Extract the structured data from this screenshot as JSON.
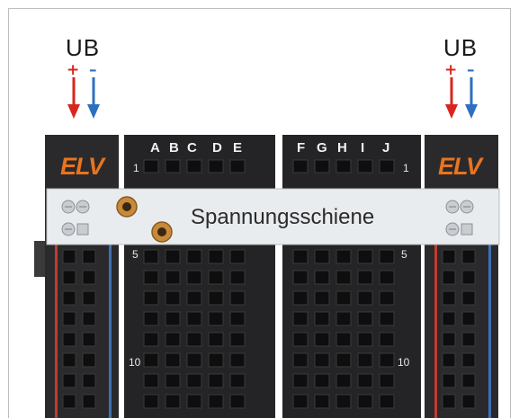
{
  "left_rail": {
    "title": "UB",
    "plus": "+",
    "minus": "–"
  },
  "right_rail": {
    "title": "UB",
    "plus": "+",
    "minus": "–"
  },
  "brand": {
    "left_logo": "ELV",
    "right_logo": "ELV"
  },
  "bar": {
    "label": "Spannungsschiene"
  },
  "columns_left": [
    "A",
    "B",
    "C",
    "D",
    "E"
  ],
  "columns_right": [
    "F",
    "G",
    "H",
    "I",
    "J"
  ],
  "row_numbers": {
    "r1": "1",
    "r5": "5",
    "r10": "10"
  },
  "colors": {
    "plus_red": "#d8261e",
    "minus_blue": "#2f6fc0",
    "logo_orange": "#e8741e",
    "board_dark": "#2a2a2c"
  }
}
